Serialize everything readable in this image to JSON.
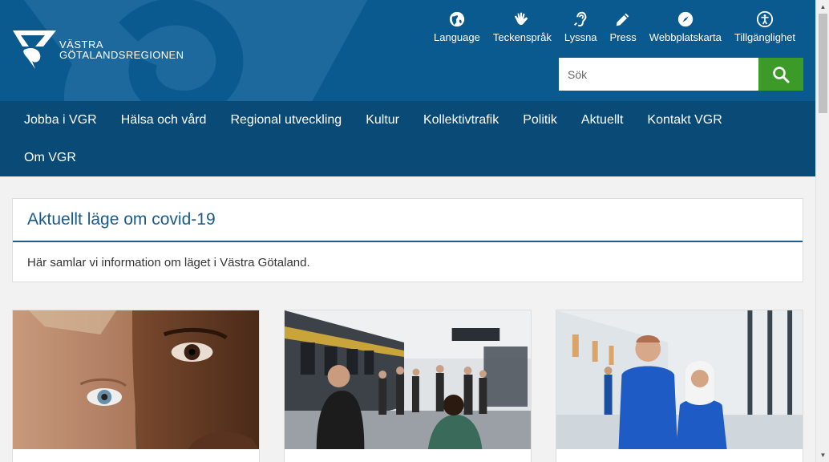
{
  "header": {
    "logo_line1": "VÄSTRA",
    "logo_line2": "GÖTALANDSREGIONEN",
    "colors": {
      "header_bg": "#0b5a8f",
      "nav_bg": "#0a4a76",
      "search_btn": "#3c9a29"
    }
  },
  "tools": [
    {
      "label": "Language",
      "icon": "globe-icon"
    },
    {
      "label": "Teckenspråk",
      "icon": "sign-language-icon"
    },
    {
      "label": "Lyssna",
      "icon": "ear-icon"
    },
    {
      "label": "Press",
      "icon": "pencil-icon"
    },
    {
      "label": "Webbplatskarta",
      "icon": "compass-icon"
    },
    {
      "label": "Tillgänglighet",
      "icon": "accessibility-icon"
    }
  ],
  "search": {
    "placeholder": "Sök",
    "value": ""
  },
  "nav": {
    "row1": [
      "Jobba i VGR",
      "Hälsa och vård",
      "Regional utveckling",
      "Kultur",
      "Kollektivtrafik",
      "Politik",
      "Aktuellt",
      "Kontakt VGR"
    ],
    "row2": [
      "Om VGR"
    ]
  },
  "covid": {
    "title": "Aktuellt läge om covid-19",
    "text": "Här samlar vi information om läget i Västra Götaland."
  },
  "cards": [
    {
      "image": "two-faces-photo"
    },
    {
      "image": "train-station-photo"
    },
    {
      "image": "healthcare-staff-photo"
    }
  ]
}
